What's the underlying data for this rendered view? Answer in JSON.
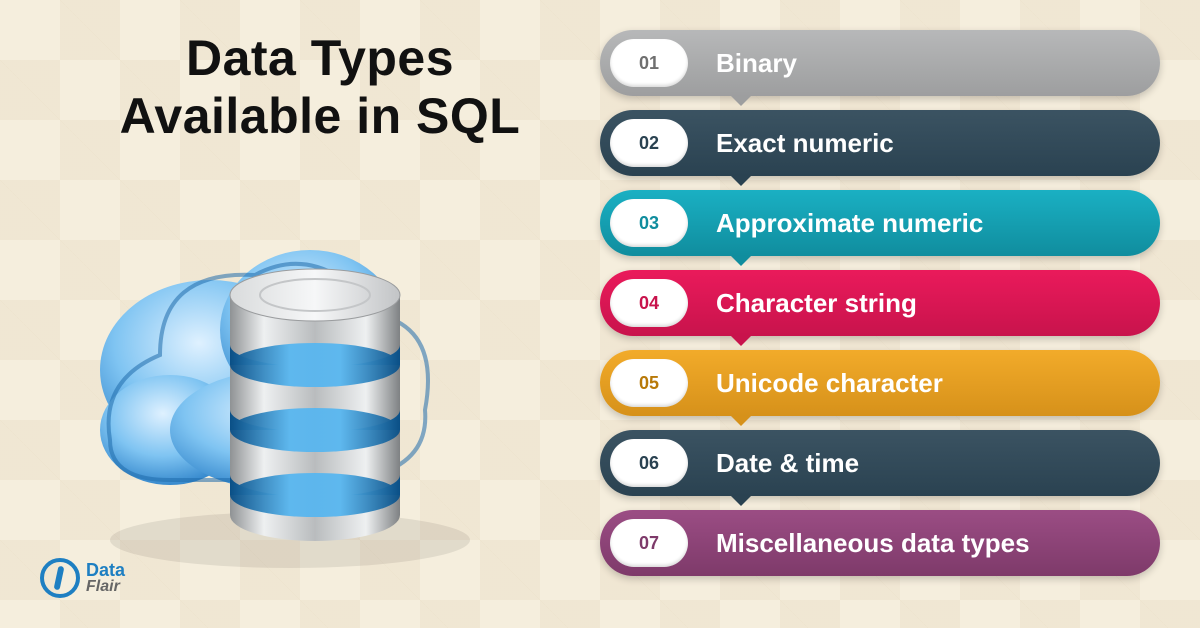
{
  "title_line1": "Data Types",
  "title_line2": "Available in SQL",
  "items": [
    {
      "num": "01",
      "label": "Binary"
    },
    {
      "num": "02",
      "label": "Exact numeric"
    },
    {
      "num": "03",
      "label": "Approximate numeric"
    },
    {
      "num": "04",
      "label": "Character string"
    },
    {
      "num": "05",
      "label": "Unicode character"
    },
    {
      "num": "06",
      "label": "Date & time"
    },
    {
      "num": "07",
      "label": "Miscellaneous data types"
    }
  ],
  "logo": {
    "top": "Data",
    "bottom": "Flair"
  }
}
